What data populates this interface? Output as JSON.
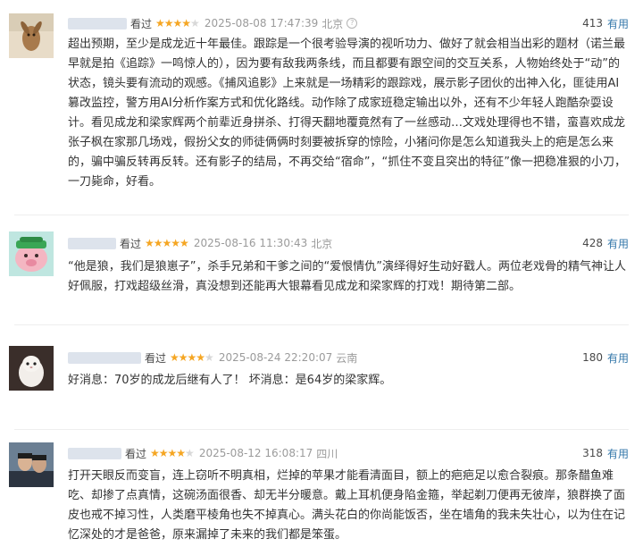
{
  "reviews": [
    {
      "status": "看过",
      "rating": 4,
      "datetime": "2025-08-08 17:47:39",
      "location": "北京",
      "votes": "413",
      "vote_label": "有用",
      "content": "超出预期，至少是成龙近十年最佳。跟踪是一个很考验导演的视听功力、做好了就会相当出彩的题材（诺兰最早就是拍《追踪》一鸣惊人的），因为要有敌我两条线，而且都要有跟空间的交互关系，人物始终处于“动”的状态，镜头要有流动的观感。《捕风追影》上来就是一场精彩的跟踪戏，展示影子团伙的出神入化，匪徒用AI篡改监控，警方用AI分析作案方式和优化路线。动作除了成家班稳定输出以外，还有不少年轻人跑酷杂耍设计。看见成龙和梁家辉两个前辈近身拼杀、打得天翻地覆竟然有了一丝感动…文戏处理得也不错，蛮喜欢成龙张子枫在家那几场戏，假扮父女的师徒俩俩时刻要被拆穿的惊险，小猪问你是怎么知道我头上的疤是怎么来的，骗中骗反转再反转。还有影子的结局，不再交给“宿命”，“抓住不变且突出的特征”像一把稳准狠的小刀，一刀毙命，好看。"
    },
    {
      "status": "看过",
      "rating": 5,
      "datetime": "2025-08-16 11:30:43",
      "location": "北京",
      "votes": "428",
      "vote_label": "有用",
      "content": "“他是狼，我们是狼崽子”，杀手兄弟和干爹之间的“爱恨情仇”演绎得好生动好戳人。两位老戏骨的精气神让人好佩服，打戏超级丝滑，真没想到还能再大银幕看见成龙和梁家辉的打戏！期待第二部。"
    },
    {
      "status": "看过",
      "rating": 4,
      "datetime": "2025-08-24 22:20:07",
      "location": "云南",
      "votes": "180",
      "vote_label": "有用",
      "content": "好消息：70岁的成龙后继有人了！ 坏消息：是64岁的梁家辉。"
    },
    {
      "status": "看过",
      "rating": 4,
      "datetime": "2025-08-12 16:08:17",
      "location": "四川",
      "votes": "318",
      "vote_label": "有用",
      "content": "打开天眼反而变盲，连上窃听不明真相，烂掉的苹果才能看清面目，额上的疤疤足以愈合裂痕。那条醋鱼难吃、却掺了点真情，这碗汤面很香、却无半分暖意。戴上耳机便身陷金箍，举起剃刀便再无彼岸，狼群换了面皮也戒不掉习性，人类磨平棱角也失不掉真心。满头花白的你尚能饭否，坐在墙角的我未失壮心，以为住在记忆深处的才是爸爸，原来漏掉了未来的我们都是笨蛋。"
    }
  ]
}
